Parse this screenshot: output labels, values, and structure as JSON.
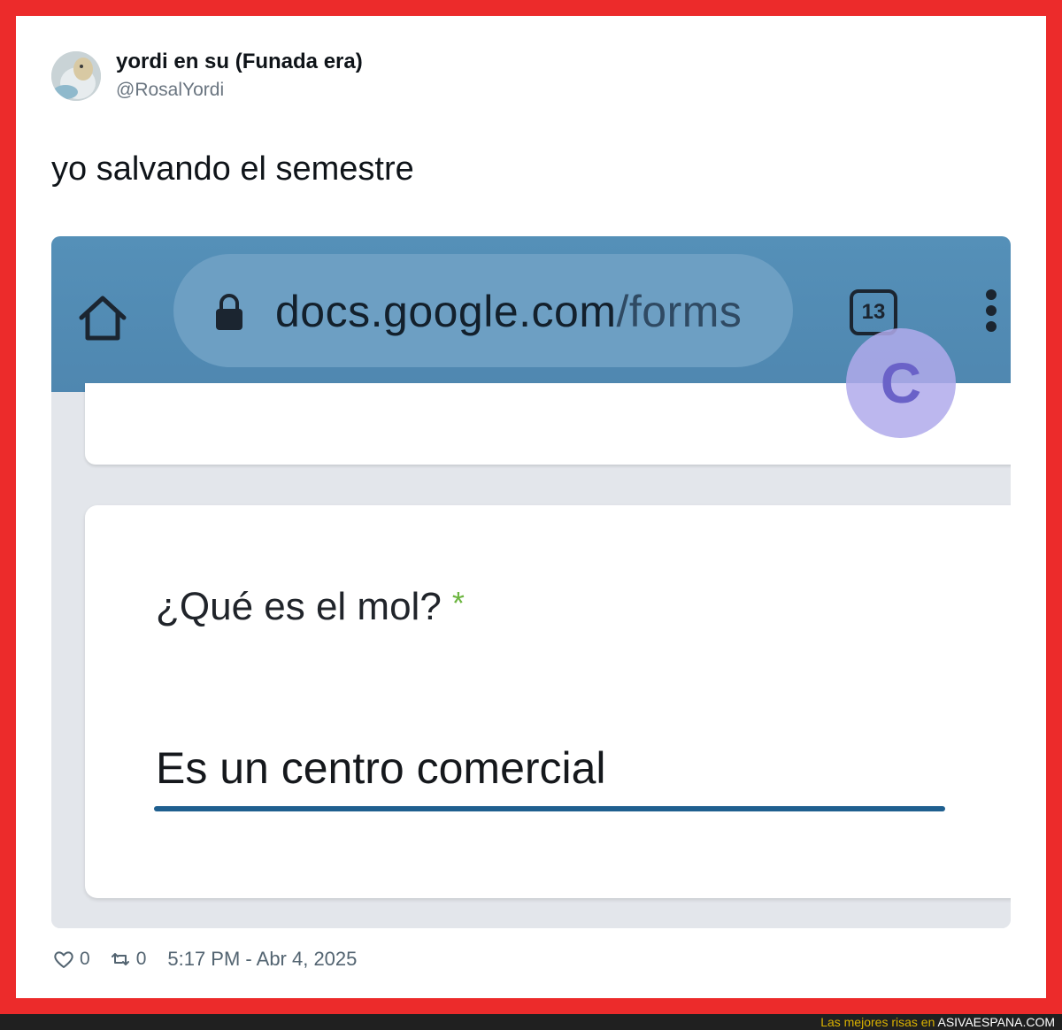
{
  "tweet": {
    "display_name": "yordi en su (Funada era)",
    "handle": "@RosalYordi",
    "text": "yo salvando el semestre",
    "likes": "0",
    "retweets": "0",
    "timestamp": "5:17 PM - Abr 4, 2025"
  },
  "screenshot": {
    "url_domain": "docs.google.com",
    "url_path": "/forms",
    "tab_count": "13",
    "badge_letter": "C",
    "question": "¿Qué es el mol?",
    "required_marker": "*",
    "answer": "Es un centro comercial"
  },
  "footer": {
    "prefix": "Las mejores risas en ",
    "site": "ASIVAESPANA.COM"
  },
  "colors": {
    "frame": "#ec2b2b",
    "browser_bar": "#5590b8",
    "answer_underline": "#1f5f8f",
    "required_star": "#6cb540"
  }
}
